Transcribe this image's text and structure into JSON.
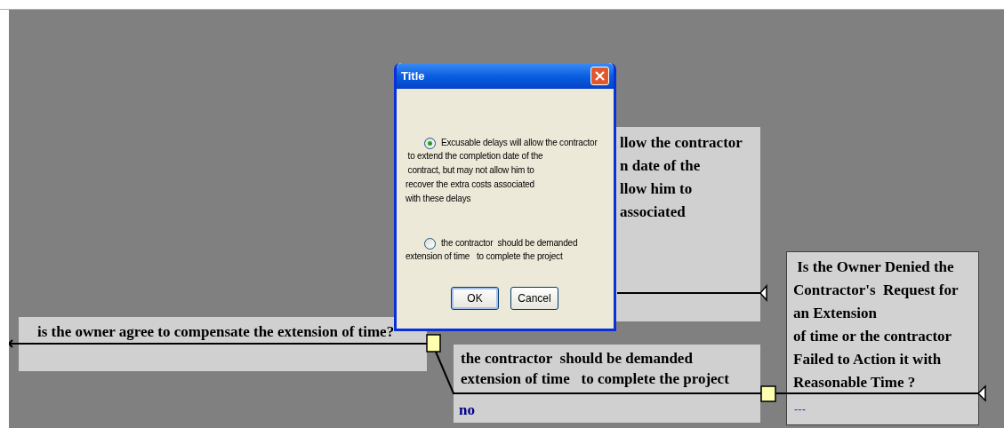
{
  "dialog": {
    "title": "Title",
    "options": [
      {
        "label": "Excusable delays will allow the contractor\n to extend the completion date of the\n contract, but may not allow him to\nrecover the extra costs associated\nwith these delays",
        "selected": true
      },
      {
        "label": "the contractor  should be demanded\nextension of time   to complete the project",
        "selected": false
      }
    ],
    "buttons": [
      "OK",
      "Cancel"
    ]
  },
  "nodes": [
    {
      "kind": "partial",
      "lines": [
        "llow the contractor",
        "n date of the",
        "llow him to",
        "associated"
      ]
    },
    {
      "kind": "question",
      "text": "is the owner agree to compensate the extension of time?"
    },
    {
      "kind": "answer",
      "text": "the contractor  should be demanded\nextension of time   to complete the project",
      "answer": "no"
    },
    {
      "kind": "decision",
      "text": " Is the Owner Denied the\nContractor's  Request for\nan Extension\nof time or the contractor\nFailed to Action it with\nReasonable Time ?",
      "answer": "---"
    }
  ]
}
